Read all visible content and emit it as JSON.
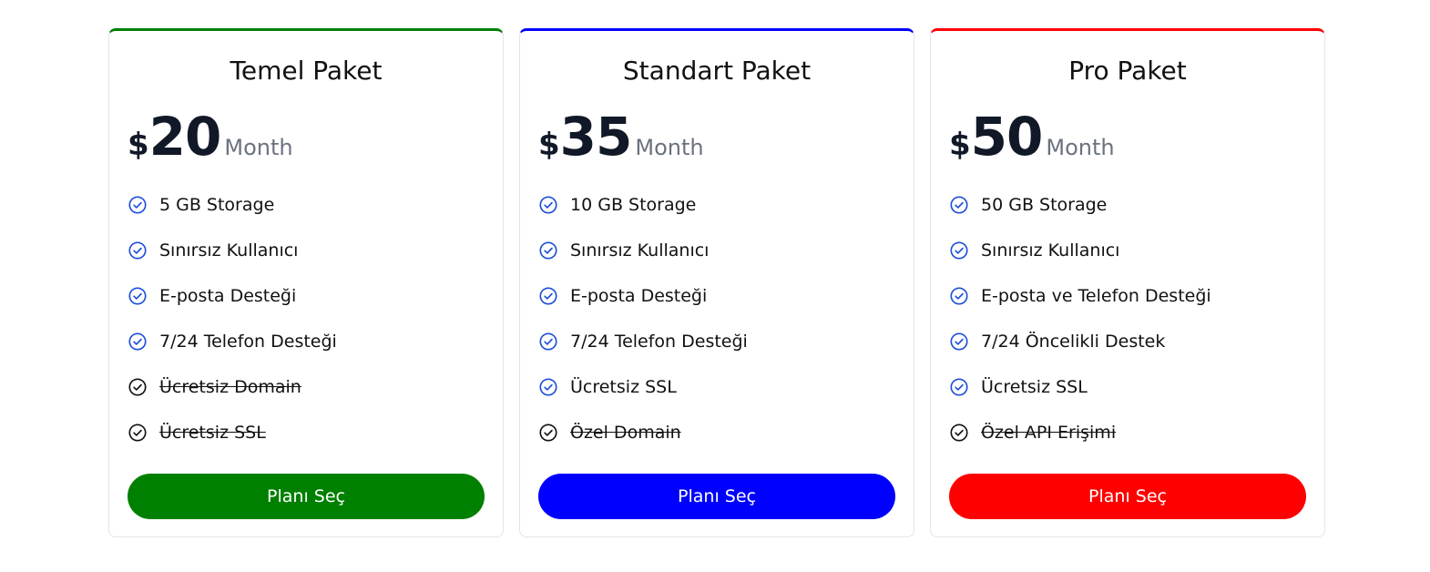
{
  "plans": [
    {
      "title": "Temel Paket",
      "currency": "$",
      "price": "20",
      "period": "Month",
      "accent": "#008000",
      "button_label": "Planı Seç",
      "features": [
        {
          "label": "5 GB Storage",
          "included": true
        },
        {
          "label": "Sınırsız Kullanıcı",
          "included": true
        },
        {
          "label": "E-posta Desteği",
          "included": true
        },
        {
          "label": "7/24 Telefon Desteği",
          "included": true
        },
        {
          "label": "Ücretsiz Domain",
          "included": false
        },
        {
          "label": "Ücretsiz SSL",
          "included": false
        }
      ]
    },
    {
      "title": "Standart Paket",
      "currency": "$",
      "price": "35",
      "period": "Month",
      "accent": "#0000ff",
      "button_label": "Planı Seç",
      "features": [
        {
          "label": "10 GB Storage",
          "included": true
        },
        {
          "label": "Sınırsız Kullanıcı",
          "included": true
        },
        {
          "label": "E-posta Desteği",
          "included": true
        },
        {
          "label": "7/24 Telefon Desteği",
          "included": true
        },
        {
          "label": "Ücretsiz SSL",
          "included": true
        },
        {
          "label": "Özel Domain",
          "included": false
        }
      ]
    },
    {
      "title": "Pro Paket",
      "currency": "$",
      "price": "50",
      "period": "Month",
      "accent": "#ff0000",
      "button_label": "Planı Seç",
      "features": [
        {
          "label": "50 GB Storage",
          "included": true
        },
        {
          "label": "Sınırsız Kullanıcı",
          "included": true
        },
        {
          "label": "E-posta ve Telefon Desteği",
          "included": true
        },
        {
          "label": "7/24 Öncelikli Destek",
          "included": true
        },
        {
          "label": "Ücretsiz SSL",
          "included": true
        },
        {
          "label": "Özel API Erişimi",
          "included": false
        }
      ]
    }
  ],
  "icons": {
    "included": "check-circle-icon",
    "excluded": "check-circle-icon"
  },
  "colors": {
    "check_included": "#1d4ed8",
    "check_excluded": "#111111",
    "period_text": "#6b7280",
    "price_text": "#111827"
  }
}
